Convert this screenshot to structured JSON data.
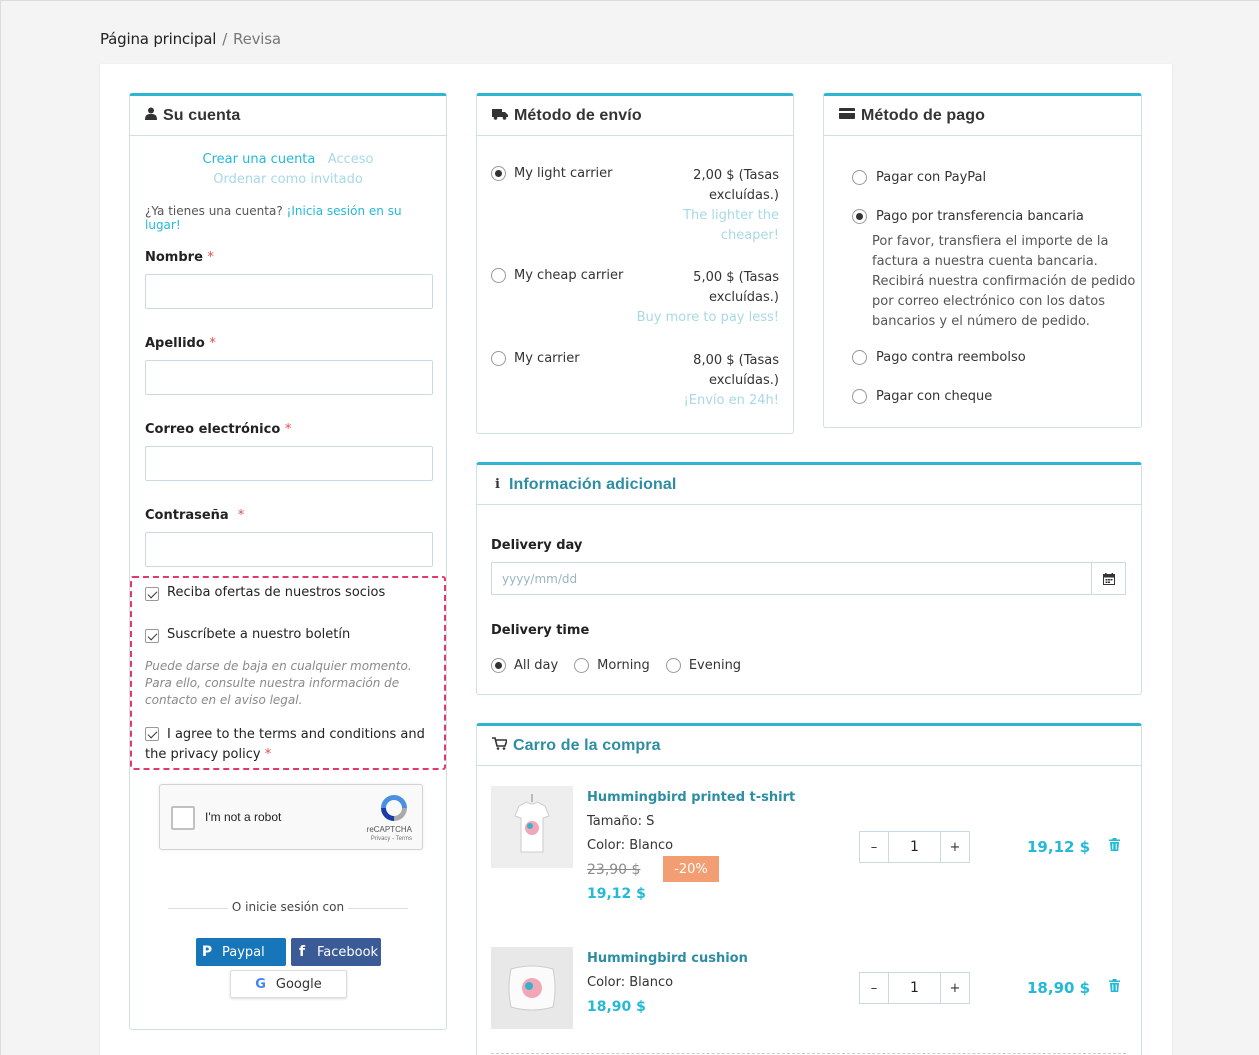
{
  "breadcrumb": {
    "home": "Página principal",
    "separator": "/",
    "current": "Revisa"
  },
  "account": {
    "title": "Su cuenta",
    "icon": "user-icon",
    "create_link": "Crear una cuenta",
    "login_link": "Acceso",
    "guest_link": "Ordenar como invitado",
    "have_account": "¿Ya tienes una cuenta?",
    "signin_link": "¡Inicia sesión en su lugar!",
    "required_mark": "*",
    "fields": {
      "first_name": "Nombre",
      "last_name": "Apellido",
      "email": "Correo electrónico",
      "password": "Contraseña"
    },
    "checks": {
      "partners": "Reciba ofertas de nuestros socios",
      "newsletter": "Suscríbete a nuestro boletín",
      "newsletter_note": "Puede darse de baja en cualquier momento. Para ello, consulte nuestra información de contacto en el aviso legal.",
      "terms": "I agree to the terms and conditions and the privacy policy"
    },
    "captcha": {
      "label": "I'm not a robot",
      "brand": "reCAPTCHA",
      "links": "Privacy - Terms"
    },
    "social": {
      "or_text": "O inicie sesión con",
      "paypal": "Paypal",
      "facebook": "Facebook",
      "google": "Google"
    }
  },
  "shipping": {
    "title": "Método de envío",
    "icon": "truck-icon",
    "carriers": [
      {
        "name": "My light carrier",
        "price": "2,00 $ (Tasas excluídas.)",
        "delay": "The lighter the cheaper!",
        "selected": true
      },
      {
        "name": "My cheap carrier",
        "price": "5,00 $ (Tasas excluídas.)",
        "delay": "Buy more to pay less!",
        "selected": false
      },
      {
        "name": "My carrier",
        "price": "8,00 $ (Tasas excluídas.)",
        "delay": "¡Envío en 24h!",
        "selected": false
      }
    ]
  },
  "payment": {
    "title": "Método de pago",
    "icon": "credit-card-icon",
    "options": [
      "Pagar con PayPal",
      "Pago por transferencia bancaria",
      "Pago contra reembolso",
      "Pagar con cheque"
    ],
    "selected_index": 1,
    "bank_description": "Por favor, transfiera el importe de la factura a nuestra cuenta bancaria. Recibirá nuestra confirmación de pedido por correo electrónico con los datos bancarios y el número de pedido."
  },
  "info": {
    "title": "Información adicional",
    "icon": "info-icon",
    "delivery_day_label": "Delivery day",
    "date_placeholder": "yyyy/mm/dd",
    "delivery_time_label": "Delivery time",
    "times": [
      "All day",
      "Morning",
      "Evening"
    ],
    "selected_time": 0
  },
  "cart": {
    "title": "Carro de la compra",
    "icon": "cart-icon",
    "items": [
      {
        "name": "Hummingbird printed t-shirt",
        "size": "Tamaño: S",
        "color": "Color: Blanco",
        "old_price": "23,90 $",
        "discount": "-20%",
        "price": "19,12 $",
        "qty": "1",
        "total": "19,12 $"
      },
      {
        "name": "Hummingbird cushion",
        "color": "Color: Blanco",
        "price": "18,90 $",
        "qty": "1",
        "total": "18,90 $"
      }
    ],
    "minus": "–",
    "plus": "+"
  },
  "colors": {
    "accent": "#2fb5d2",
    "required": "#e64a4a",
    "highlight_border": "#e0396a",
    "discount": "#f39d72"
  }
}
